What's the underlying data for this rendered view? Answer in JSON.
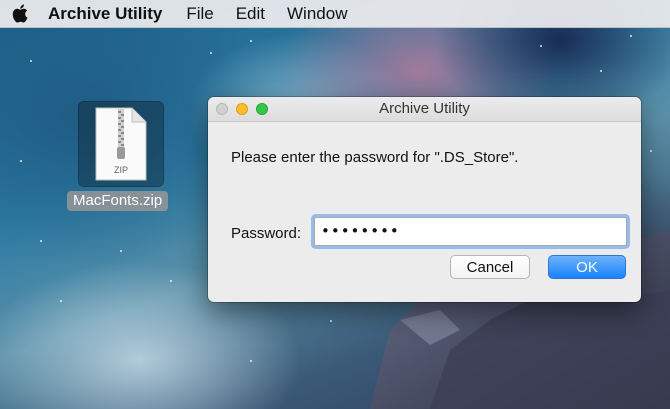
{
  "menubar": {
    "apple_icon": "apple-logo-icon",
    "app_name": "Archive Utility",
    "menus": [
      "File",
      "Edit",
      "Window"
    ]
  },
  "desktop": {
    "file": {
      "icon": "zip-file-icon",
      "icon_text": "ZIP",
      "name": "MacFonts.zip"
    }
  },
  "dialog": {
    "title": "Archive Utility",
    "message": "Please enter the password for \".DS_Store\".",
    "password_label": "Password:",
    "password_value": "••••••••",
    "cancel_label": "Cancel",
    "ok_label": "OK",
    "colors": {
      "close": "#d0d0d0",
      "minimize": "#fdbb2e",
      "zoom": "#35c648",
      "accent": "#1a82fb",
      "focus_ring": "#78aaeb"
    }
  }
}
